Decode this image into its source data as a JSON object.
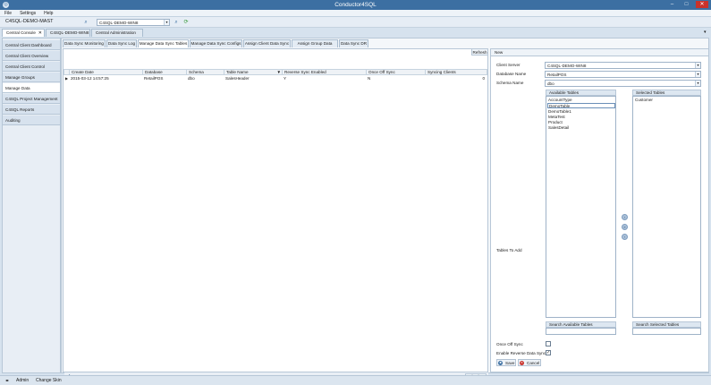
{
  "window": {
    "title": "Conductor4SQL"
  },
  "menu": [
    "File",
    "Settings",
    "Help"
  ],
  "toolbar": {
    "server_label": "C4SQL-DEMO-MAST",
    "server_combo": "C4SQL-DEMO-WIN8"
  },
  "doc_tabs": [
    "Central Console",
    "C4SQL-DEMO-WIN8",
    "Central Administration"
  ],
  "sidebar": [
    "Central Client Dashboard",
    "Central Client Overview",
    "Central Client Control",
    "Manage Groups",
    "Manage Data Synchronisation",
    "C4SQL Project Management",
    "C4SQL Reports",
    "Auditing"
  ],
  "inner_tabs": [
    "Data Sync Monitoring",
    "Data Sync Log",
    "Manage Data Sync Tables",
    "Manage Data Sync Configs",
    "Assign Client Data Sync",
    "Assign Group Data Sync",
    "Data Sync DR"
  ],
  "grid": {
    "refresh": "Refresh",
    "columns": [
      "Create Date",
      "Database",
      "Schema",
      "Table Name",
      "Reverse Sync Enabled",
      "Once Off Sync",
      "Syncing Clients"
    ],
    "rows": [
      [
        "2015-03-12 14:57:25",
        "RetailPOS",
        "dbo",
        "SalesHeader",
        "Y",
        "N",
        "0"
      ]
    ],
    "edit_filter": "Edit Filter"
  },
  "detail": {
    "header": "New",
    "client_server_label": "Client Server",
    "client_server": "C4SQL-DEMO-WIN8",
    "database_label": "Database Name",
    "database": "RetailPOS",
    "schema_label": "Schema Name",
    "schema": "dbo",
    "available_header": "Available Tables",
    "available": [
      "AccountType",
      "DemoTable",
      "DemoTable1",
      "MetaTest",
      "Product",
      "SalesDetail"
    ],
    "selected_header": "Selected Tables",
    "selected": [
      "Customer"
    ],
    "tables_to_add": "Tables To Add",
    "search_available": "Search Available Tables",
    "search_selected": "Search Selected Tables",
    "once_off": "Once Off Sync",
    "reverse": "Enable Reverse Data Sync",
    "save": "Save",
    "cancel": "Cancel"
  },
  "status": {
    "user": "Admin",
    "skin": "Change Skin"
  }
}
